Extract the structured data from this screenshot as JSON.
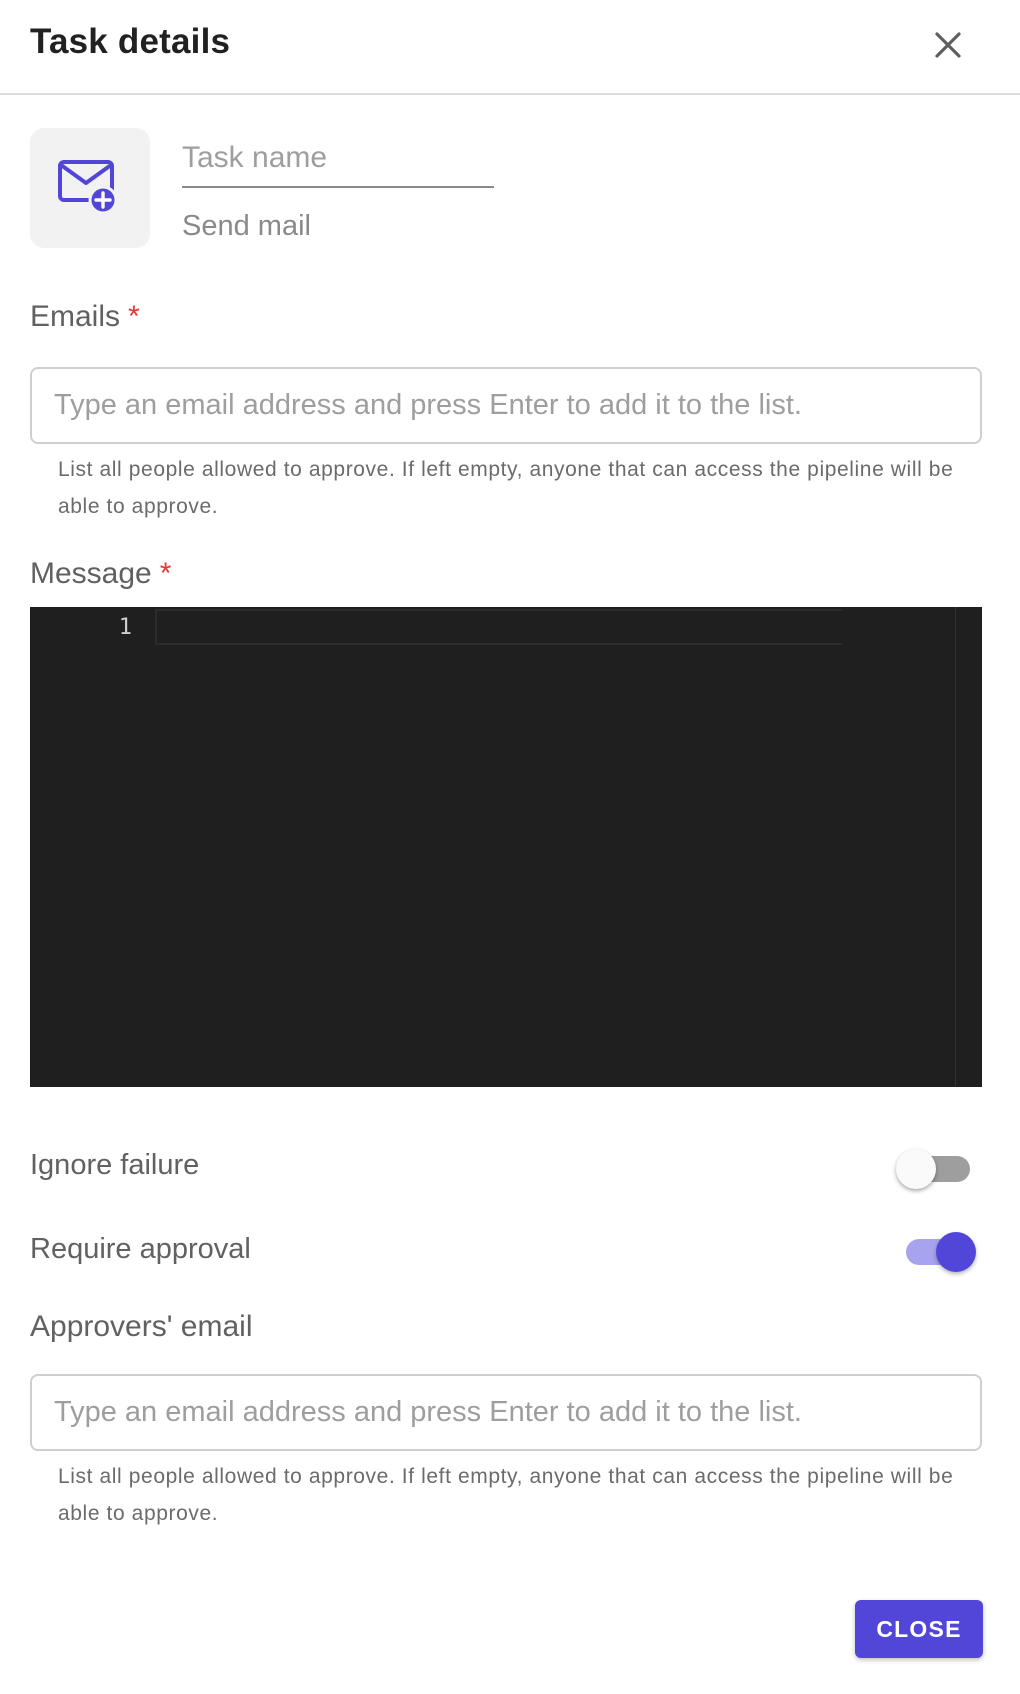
{
  "dialog": {
    "title": "Task details",
    "close_icon": "close-icon"
  },
  "task": {
    "icon": "mail-add-icon",
    "icon_color": "#5146d8",
    "name_placeholder": "Task name",
    "name_value": "",
    "type_label": "Send mail"
  },
  "emails": {
    "label": "Emails",
    "required_mark": "*",
    "placeholder": "Type an email address and press Enter to add it to the list.",
    "value": "",
    "helper": "List all people allowed to approve. If left empty, anyone that can access the pipeline will be able to approve."
  },
  "message": {
    "label": "Message",
    "required_mark": "*",
    "line_number": "1",
    "content": ""
  },
  "ignore_failure": {
    "label": "Ignore failure",
    "enabled": false
  },
  "require_approval": {
    "label": "Require approval",
    "enabled": true
  },
  "approvers": {
    "label": "Approvers' email",
    "placeholder": "Type an email address and press Enter to add it to the list.",
    "value": "",
    "helper": "List all people allowed to approve. If left empty, anyone that can access the pipeline will be able to approve."
  },
  "actions": {
    "close_label": "CLOSE"
  },
  "colors": {
    "accent": "#5146d8",
    "required": "#e53935",
    "editor_background": "#1f1f1f"
  }
}
